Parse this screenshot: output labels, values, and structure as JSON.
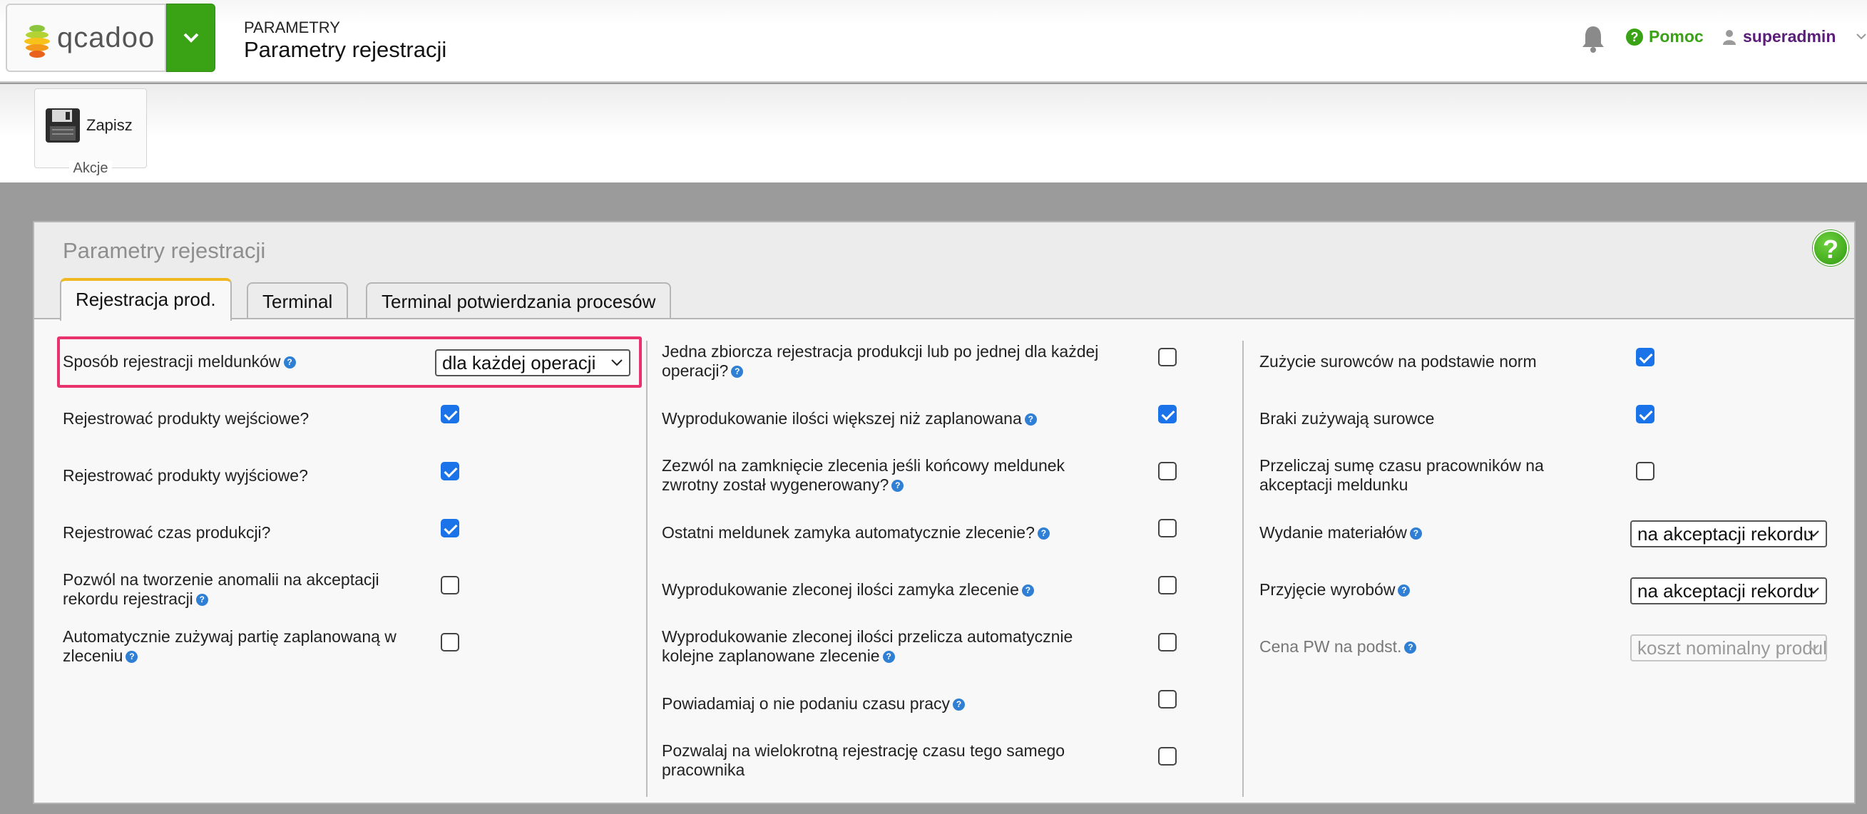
{
  "header": {
    "logo_text": "qcadoo",
    "crumb_small": "PARAMETRY",
    "crumb_big": "Parametry rejestracji",
    "help_label": "Pomoc",
    "user_label": "superadmin"
  },
  "toolbar": {
    "save_label": "Zapisz",
    "group_label": "Akcje"
  },
  "panel": {
    "title": "Parametry rejestracji",
    "tabs": [
      {
        "label": "Rejestracja prod.",
        "active": true
      },
      {
        "label": "Terminal",
        "active": false
      },
      {
        "label": "Terminal potwierdzania procesów",
        "active": false
      }
    ],
    "col1": [
      {
        "label": "Sposób rejestracji meldunków",
        "help": true,
        "type": "select",
        "value": "dla każdej operacji"
      },
      {
        "label": "Rejestrować produkty wejściowe?",
        "type": "checkbox",
        "checked": true
      },
      {
        "label": "Rejestrować produkty wyjściowe?",
        "type": "checkbox",
        "checked": true
      },
      {
        "label": "Rejestrować czas produkcji?",
        "type": "checkbox",
        "checked": true
      },
      {
        "label": "Pozwól na tworzenie anomalii na akceptacji rekordu rejestracji",
        "help": true,
        "type": "checkbox",
        "checked": false
      },
      {
        "label": "Automatycznie zużywaj partię zaplanowaną w zleceniu",
        "help": true,
        "type": "checkbox",
        "checked": false
      }
    ],
    "col2": [
      {
        "label": "Jedna zbiorcza rejestracja produkcji lub po jednej dla każdej operacji?",
        "help": true,
        "type": "checkbox",
        "checked": false
      },
      {
        "label": "Wyprodukowanie ilości większej niż zaplanowana",
        "help": true,
        "type": "checkbox",
        "checked": true
      },
      {
        "label": "Zezwól na zamknięcie zlecenia jeśli końcowy meldunek zwrotny został wygenerowany?",
        "help": true,
        "type": "checkbox",
        "checked": false
      },
      {
        "label": "Ostatni meldunek zamyka automatycznie zlecenie?",
        "help": true,
        "type": "checkbox",
        "checked": false
      },
      {
        "label": "Wyprodukowanie zleconej ilości zamyka zlecenie",
        "help": true,
        "type": "checkbox",
        "checked": false
      },
      {
        "label": "Wyprodukowanie zleconej ilości przelicza automatycznie kolejne zaplanowane zlecenie",
        "help": true,
        "type": "checkbox",
        "checked": false
      },
      {
        "label": "Powiadamiaj o nie podaniu czasu pracy",
        "help": true,
        "type": "checkbox",
        "checked": false
      },
      {
        "label": "Pozwalaj na wielokrotną rejestrację czasu tego samego pracownika",
        "type": "checkbox",
        "checked": false
      }
    ],
    "col3": [
      {
        "label": "Zużycie surowców na podstawie norm",
        "type": "checkbox",
        "checked": true
      },
      {
        "label": "Braki zużywają surowce",
        "type": "checkbox",
        "checked": true
      },
      {
        "label": "Przeliczaj sumę czasu pracowników na akceptacji meldunku",
        "type": "checkbox",
        "checked": false
      },
      {
        "label": "Wydanie materiałów",
        "help": true,
        "type": "select",
        "value": "na akceptacji rekordu"
      },
      {
        "label": "Przyjęcie wyrobów",
        "help": true,
        "type": "select",
        "value": "na akceptacji rekordu"
      },
      {
        "label": "Cena PW na podst.",
        "help": true,
        "type": "select",
        "value": "koszt nominalny produktu",
        "disabled": true
      }
    ]
  },
  "colors": {
    "brand_green": "#3aa315",
    "checkbox_blue": "#1a73e8",
    "highlight_pink": "#e8336e",
    "tab_active_accent": "#f0b820"
  }
}
